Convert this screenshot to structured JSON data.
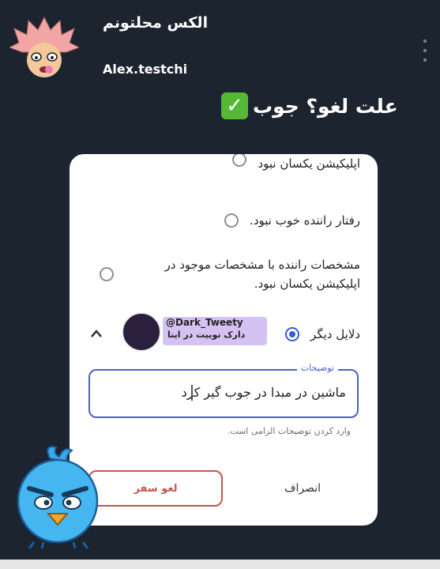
{
  "post": {
    "author_name": "الکس محلتونم",
    "author_handle": "Alex.testchi",
    "headline": "علت لغو؟ جوب"
  },
  "form": {
    "options": [
      {
        "label": "اپلیکیشن یکسان نبود",
        "selected": false
      },
      {
        "label": "رفتار راننده خوب نبود.",
        "selected": false
      },
      {
        "label": "مشخصات راننده با مشخصات موجود در اپلیکیشن یکسان نبود.",
        "selected": false
      },
      {
        "label": "دلایل دیگر",
        "selected": true
      }
    ],
    "description_label": "توضیحات",
    "description_value": "ماشین در مبدا در جوب گیر کرد",
    "helper_text": "وارد کردن توضیحات الزامی است.",
    "cancel_trip_button": "لغو سفر",
    "dismiss_button": "انصراف"
  },
  "watermark": {
    "handle": "@Dark_Tweety",
    "subtitle": "دارک توییت در ایتا"
  },
  "colors": {
    "background": "#1c2430",
    "accent": "#4b5fcf",
    "danger": "#c0574f",
    "check": "#56b936"
  }
}
